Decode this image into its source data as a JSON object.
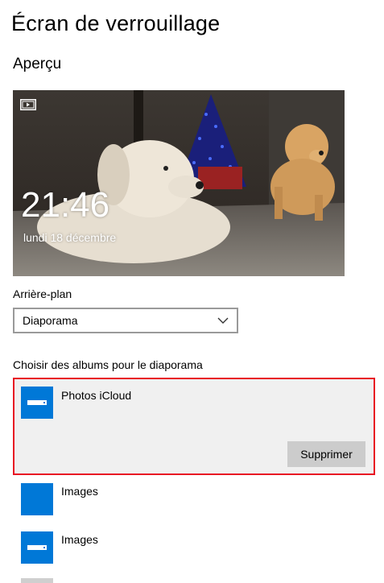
{
  "header": {
    "title": "Écran de verrouillage"
  },
  "preview": {
    "section_title": "Aperçu",
    "time": "21:46",
    "date": "lundi 18 décembre",
    "slideshow_icon": "slideshow-icon"
  },
  "background": {
    "label": "Arrière-plan",
    "selected": "Diaporama"
  },
  "albums": {
    "label": "Choisir des albums pour le diaporama",
    "items": [
      {
        "name": "Photos iCloud",
        "icon": "drive-icon",
        "selected": true,
        "remove_label": "Supprimer"
      },
      {
        "name": "Images",
        "icon": "folder-icon",
        "selected": false
      },
      {
        "name": "Images",
        "icon": "drive-icon",
        "selected": false
      }
    ]
  },
  "colors": {
    "accent": "#0078d7",
    "selection_border": "#e81123",
    "button_bg": "#cccccc"
  }
}
